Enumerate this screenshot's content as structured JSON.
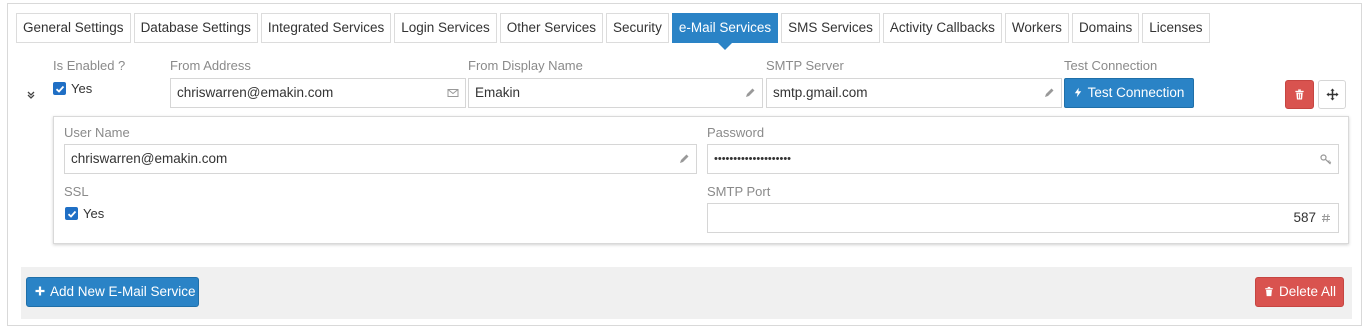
{
  "tabs": [
    {
      "label": "General Settings"
    },
    {
      "label": "Database Settings"
    },
    {
      "label": "Integrated Services"
    },
    {
      "label": "Login Services"
    },
    {
      "label": "Other Services"
    },
    {
      "label": "Security"
    },
    {
      "label": "e-Mail Services",
      "active": true
    },
    {
      "label": "SMS Services"
    },
    {
      "label": "Activity Callbacks"
    },
    {
      "label": "Workers"
    },
    {
      "label": "Domains"
    },
    {
      "label": "Licenses"
    }
  ],
  "service": {
    "is_enabled_label": "Is Enabled ?",
    "is_enabled_value": "Yes",
    "from_address_label": "From Address",
    "from_address_value": "chriswarren@emakin.com",
    "from_display_name_label": "From Display Name",
    "from_display_name_value": "Emakin",
    "smtp_server_label": "SMTP Server",
    "smtp_server_value": "smtp.gmail.com",
    "test_connection_label": "Test Connection",
    "test_connection_button": "Test Connection",
    "details": {
      "user_name_label": "User Name",
      "user_name_value": "chriswarren@emakin.com",
      "password_label": "Password",
      "password_value": "••••••••••••••••••••",
      "ssl_label": "SSL",
      "ssl_value": "Yes",
      "smtp_port_label": "SMTP Port",
      "smtp_port_value": "587"
    }
  },
  "footer": {
    "add_button": "Add New E-Mail Service",
    "delete_all_button": "Delete All"
  },
  "icons": {
    "expand": "double-chevron-down-icon",
    "envelope": "envelope-icon",
    "pencil": "pencil-icon",
    "bolt": "bolt-icon",
    "trash": "trash-icon",
    "move": "move-arrows-icon",
    "key": "key-icon",
    "hash": "hash-icon",
    "plus": "plus-icon",
    "checkbox": "checkbox-checked-icon"
  },
  "colors": {
    "primary": "#2a83c6",
    "danger": "#d9534f",
    "checkbox": "#1f6fc5"
  }
}
